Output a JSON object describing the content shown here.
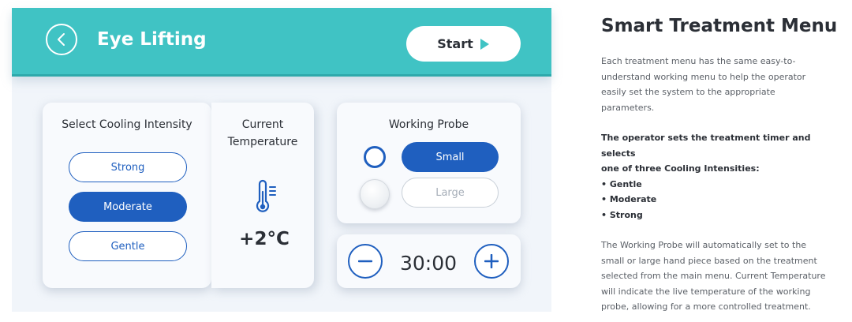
{
  "header": {
    "title": "Eye Lifting",
    "start_label": "Start"
  },
  "cooling": {
    "title": "Select Cooling Intensity",
    "options": [
      {
        "label": "Strong",
        "selected": false
      },
      {
        "label": "Moderate",
        "selected": true
      },
      {
        "label": "Gentle",
        "selected": false
      }
    ]
  },
  "temperature": {
    "title_line1": "Current",
    "title_line2": "Temperature",
    "value": "+2°C",
    "icon": "thermometer-icon"
  },
  "probe": {
    "title": "Working Probe",
    "options": [
      {
        "label": "Small",
        "selected": true
      },
      {
        "label": "Large",
        "selected": false
      }
    ]
  },
  "timer": {
    "value": "30:00",
    "minus_icon": "minus-icon",
    "plus_icon": "plus-icon"
  },
  "description": {
    "heading": "Smart Treatment Menu",
    "intro": [
      "Each treatment menu has the same easy-to-",
      "understand working menu to help the operator",
      "easily set the system to the appropriate",
      "parameters."
    ],
    "bold_lines": [
      "The operator sets the treatment timer and selects",
      "one of three Cooling Intensities:",
      "• Gentle",
      "• Moderate",
      "• Strong"
    ],
    "outro": [
      "The Working Probe will automatically set to the",
      "small or large hand piece based on the treatment",
      "selected from the main menu. Current Temperature",
      "will indicate the live temperature of the working",
      "probe, allowing for a more controlled treatment."
    ]
  },
  "colors": {
    "accent": "#40c3c4",
    "primary": "#1f5fbf",
    "background": "#f1f5fa"
  }
}
